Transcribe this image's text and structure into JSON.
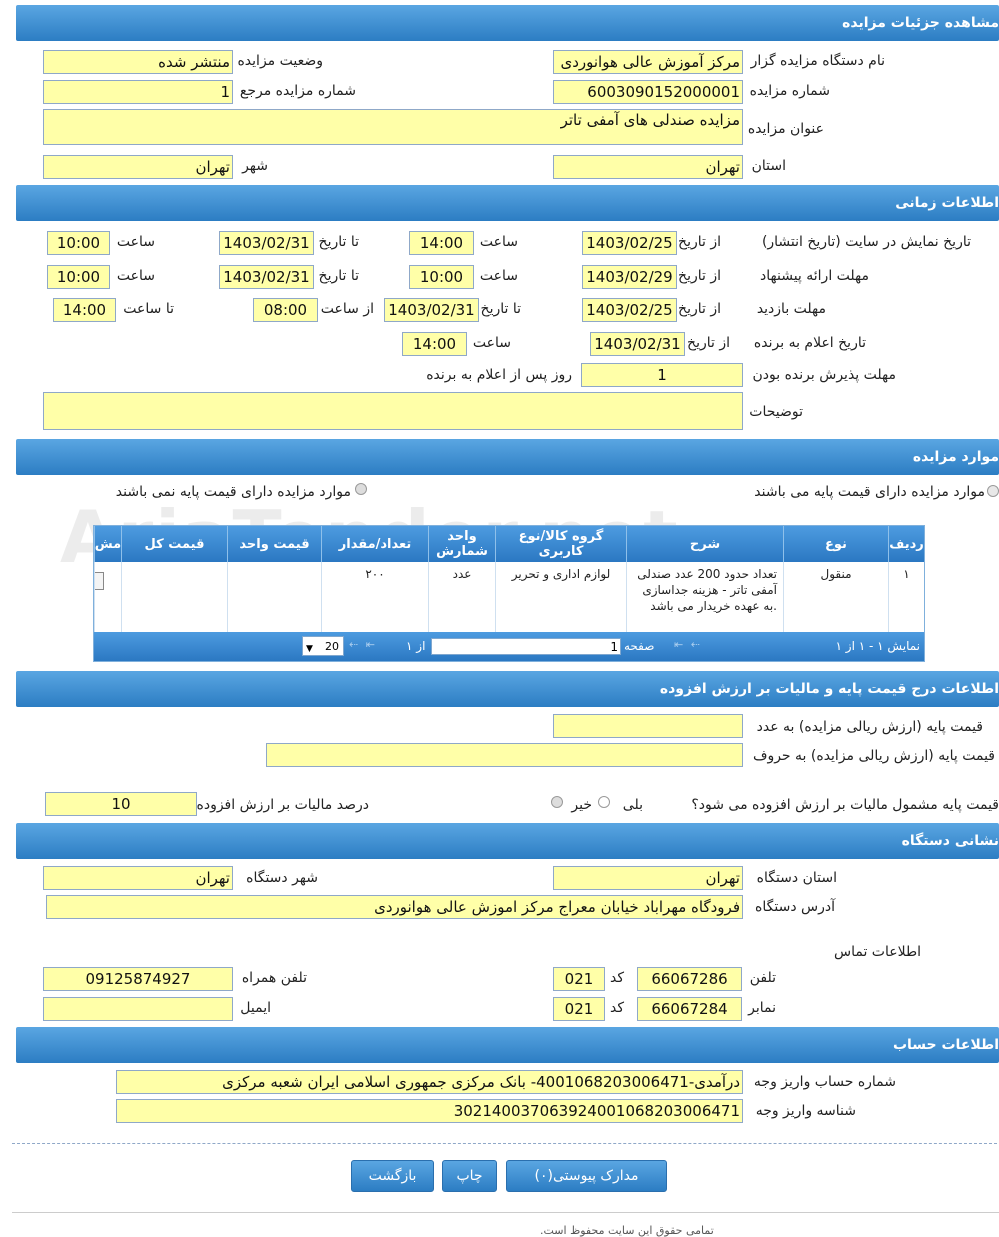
{
  "sections": {
    "details": "مشاهده جزئیات مزایده",
    "timing": "اطلاعات زمانی",
    "items": "موارد مزایده",
    "price": "اطلاعات درج قیمت پایه و مالیات بر ارزش افزوده",
    "address": "نشانی دستگاه",
    "account": "اطلاعات حساب"
  },
  "details": {
    "org_label": "نام دستگاه مزایده گزار",
    "org_value": "مرکز آموزش عالی هوانوردی",
    "status_label": "وضعیت مزایده",
    "status_value": "منتشر شده",
    "number_label": "شماره مزایده",
    "number_value": "6003090152000001",
    "ref_label": "شماره مزایده مرجع",
    "ref_value": "1",
    "title_label": "عنوان مزایده",
    "title_value": "مزایده صندلی های آمفی تاتر",
    "province_label": "استان",
    "province_value": "تهران",
    "city_label": "شهر",
    "city_value": "تهران"
  },
  "timing": {
    "display_label": "تاریخ نمایش در سایت (تاریخ انتشار)",
    "from_date": "از تاریخ",
    "to_date": "تا تاریخ",
    "hour": "ساعت",
    "d1_from": "1403/02/25",
    "d1_from_time": "14:00",
    "d1_to": "1403/02/31",
    "d1_to_time": "10:00",
    "offer_label": "مهلت ارائه پیشنهاد",
    "d2_from": "1403/02/29",
    "d2_from_time": "10:00",
    "d2_to": "1403/02/31",
    "d2_to_time": "10:00",
    "visit_label": "مهلت بازدید",
    "d3_from": "1403/02/25",
    "d3_to": "1403/02/31",
    "from_hour": "از ساعت",
    "to_hour": "تا ساعت",
    "d3_from_time": "08:00",
    "d3_to_time": "14:00",
    "winner_label": "تاریخ اعلام به برنده",
    "d4_from": "1403/02/31",
    "d4_time": "14:00",
    "accept_label": "مهلت پذیرش برنده بودن",
    "accept_value": "1",
    "accept_suffix": "روز پس از اعلام به برنده",
    "desc_label": "توضیحات",
    "desc_value": ""
  },
  "items": {
    "radio_with": "موارد مزایده دارای قیمت پایه می باشند",
    "radio_without": "موارد مزایده دارای قیمت پایه نمی باشند",
    "headers": [
      "ردیف",
      "نوع",
      "شرح",
      "گروه کالا/نوع کاربری",
      "واحد شمارش",
      "تعداد/مقدار",
      "قیمت واحد",
      "قیمت کل",
      "مش"
    ],
    "row": [
      "۱",
      "منقول",
      "تعداد حدود 200 عدد صندلی آمفی تاتر - هزینه جداسازی به عهده خریدار می باشد.",
      "لوازم اداری و تحریر",
      "عدد",
      "۲۰۰",
      "",
      "",
      ""
    ],
    "footer_range": "نمایش ۱ - ۱ از ۱",
    "page_label": "صفحه",
    "page_value": "1",
    "of_label": "از ۱",
    "page_size": "20"
  },
  "price": {
    "num_label": "قیمت پایه (ارزش ریالی مزایده) به عدد",
    "num_value": "",
    "text_label": "قیمت پایه (ارزش ریالی مزایده) به حروف",
    "text_value": "",
    "vat_q": "قیمت پایه مشمول مالیات بر ارزش افزوده می شود؟",
    "yes": "بلی",
    "no": "خیر",
    "vat_label": "درصد مالیات بر ارزش افزوده",
    "vat_value": "10"
  },
  "address": {
    "prov_label": "استان دستگاه",
    "prov_value": "تهران",
    "city_label": "شهر دستگاه",
    "city_value": "تهران",
    "addr_label": "آدرس دستگاه",
    "addr_value": "فرودگاه مهراباد خیابان معراج مرکز اموزش عالی هوانوردی",
    "contact_label": "اطلاعات تماس",
    "phone_label": "تلفن",
    "phone_value": "66067286",
    "code_label": "کد",
    "phone_code": "021",
    "mobile_label": "تلفن همراه",
    "mobile_value": "09125874927",
    "fax_label": "نمابر",
    "fax_value": "66067284",
    "fax_code": "021",
    "email_label": "ایمیل",
    "email_value": ""
  },
  "account": {
    "acc_label": "شماره حساب واریز وجه",
    "acc_value": "درآمدی-4001068203006471- بانک مرکزی جمهوری اسلامی ایران شعبه مرکزی",
    "id_label": "شناسه واریز وجه",
    "id_value": "302140037063924001068203006471"
  },
  "buttons": {
    "attachments": "مدارک پیوستی(۰)",
    "print": "چاپ",
    "back": "بازگشت"
  },
  "footer": "تمامی حقوق این سایت محفوظ است.",
  "watermark": "AriaTender.net"
}
